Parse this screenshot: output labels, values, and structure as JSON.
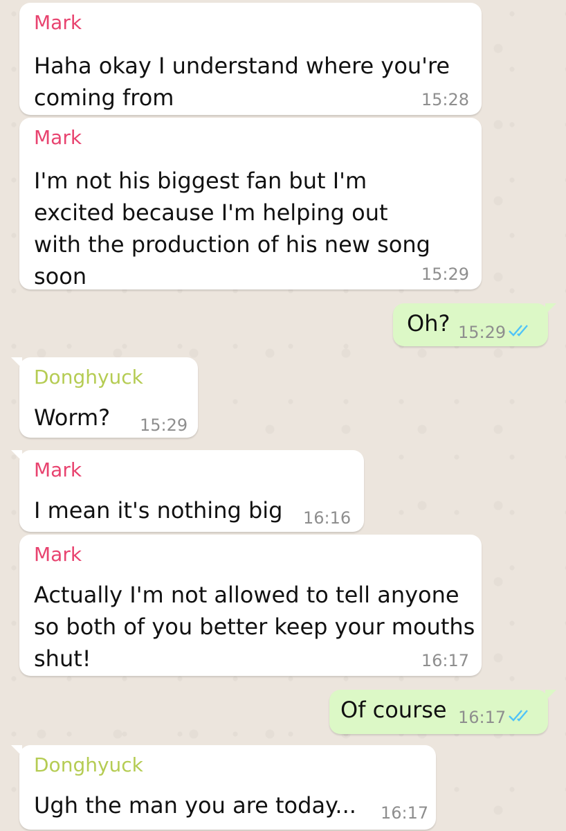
{
  "messages": [
    {
      "sender": "Mark",
      "lines": [
        "Haha okay I understand where you're",
        "coming from"
      ],
      "time": "15:28"
    },
    {
      "sender": "Mark",
      "lines": [
        "I'm not his biggest fan but I'm",
        "excited because I'm helping out",
        "with the production of his new song",
        "soon"
      ],
      "time": "15:29"
    },
    {
      "lines": [
        "Oh?"
      ],
      "time": "15:29",
      "status": "read"
    },
    {
      "sender": "Donghyuck",
      "lines": [
        "Worm?"
      ],
      "time": "15:29"
    },
    {
      "sender": "Mark",
      "lines": [
        "I mean it's nothing big"
      ],
      "time": "16:16"
    },
    {
      "sender": "Mark",
      "lines": [
        "Actually I'm not allowed to tell anyone",
        "so both of you better keep your mouths",
        "shut!"
      ],
      "time": "16:17"
    },
    {
      "lines": [
        "Of course"
      ],
      "time": "16:17",
      "status": "read"
    },
    {
      "sender": "Donghyuck",
      "lines": [
        "Ugh the man you are today..."
      ],
      "time": "16:17"
    }
  ],
  "colors": {
    "background": "#ece5dd",
    "incoming_bubble": "#ffffff",
    "outgoing_bubble": "#dcf8c6",
    "sender_mark": "#e8436f",
    "sender_donghyuck": "#b5cc53",
    "timestamp": "#8e8e8e",
    "read_ticks": "#4fc3f7"
  },
  "icons": {
    "read_receipt": "double-check-icon"
  }
}
